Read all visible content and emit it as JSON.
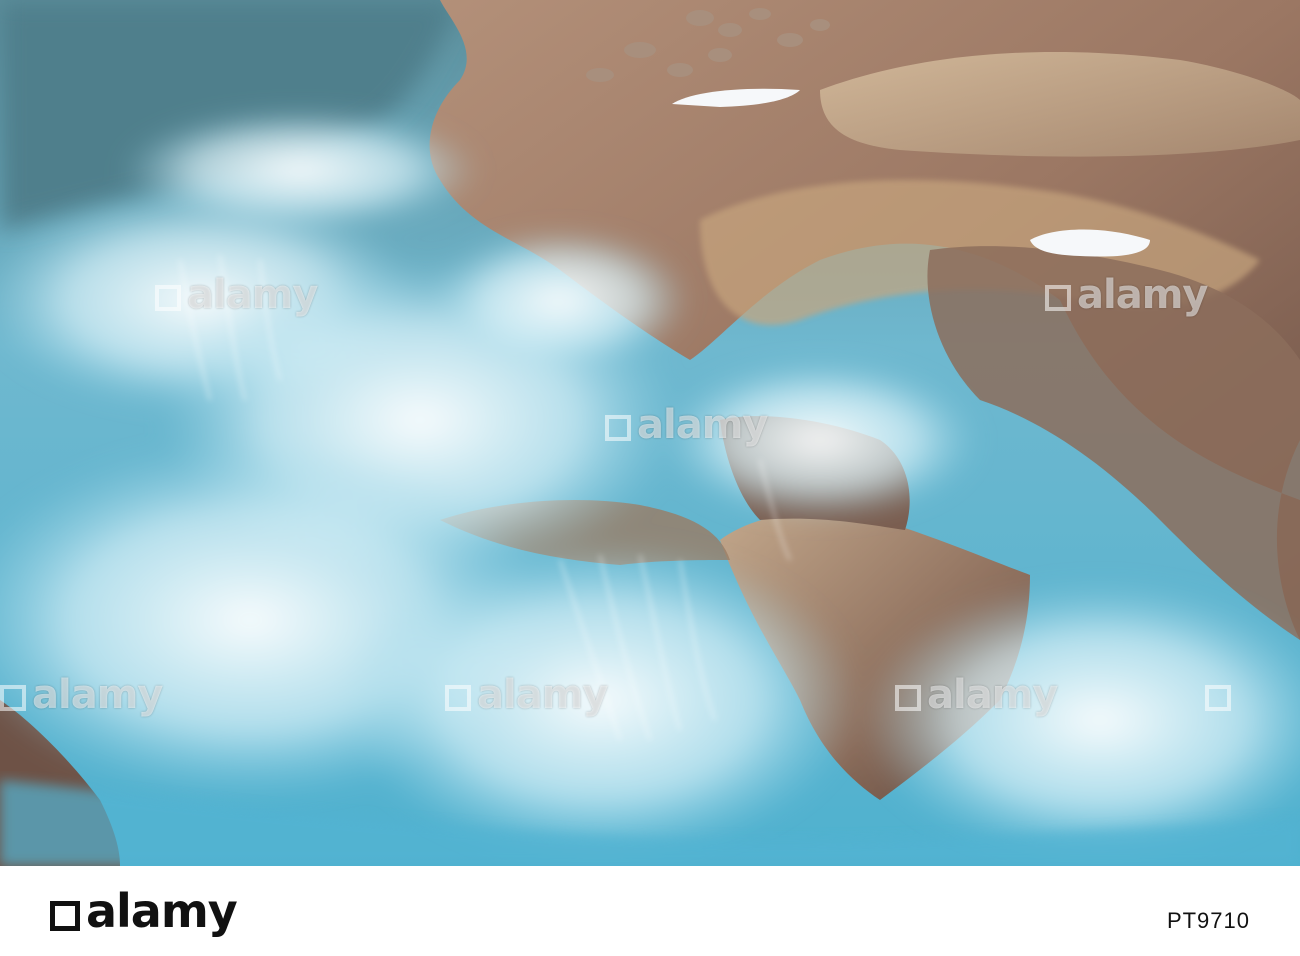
{
  "image": {
    "description_colors": {
      "water_light": "#e6f6fb",
      "water_mid": "#7cc6dc",
      "water_deep": "#2f7f99",
      "rock_light": "#c9ac8c",
      "rock_mid": "#9a7a63",
      "rock_dark": "#5e463c",
      "snow": "#f6f8fa"
    }
  },
  "watermark": {
    "brand": "alamy"
  },
  "footer": {
    "logo": "alamy",
    "stock_id": "PT9710"
  }
}
